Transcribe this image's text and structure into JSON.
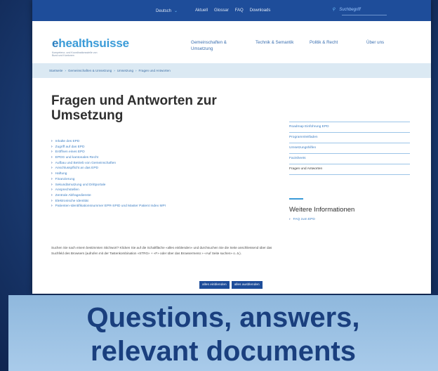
{
  "topbar": {
    "language": "Deutsch",
    "links": [
      "Aktuell",
      "Glossar",
      "FAQ",
      "Downloads"
    ],
    "search_placeholder": "Suchbegriff"
  },
  "header": {
    "logo_e": "e",
    "logo_rest": "healthsuisse",
    "logo_tagline": "Kompetenz- und Koordinationsstelle von Bund und Kantonen",
    "nav": [
      "Gemeinschaften &",
      "Umsetzung",
      "Technik & Semantik",
      "Politik & Recht",
      "Über uns"
    ]
  },
  "breadcrumb": [
    "Startseite",
    "Gemeinschaften & Umsetzung",
    "Umsetzung",
    "Fragen und Antworten"
  ],
  "main": {
    "title": "Fragen und Antworten zur Umsetzung",
    "faq_items": [
      "Inhalte des EPD",
      "Zugriff auf das EPD",
      "Eröffnen eines EPD",
      "EPDG und kantonales Recht",
      "Aufbau und Betrieb von Gemeinschaften",
      "Anschlusspflicht an das EPD",
      "Haftung",
      "Finanzierung",
      "Sekundärnutzung und Drittportale",
      "Ansprechstellen",
      "Zentrale Abfragedienste",
      "Elektronische Identität",
      "Patienten-Identifikationsnummer EPR-SPID und Master Patient Index MPI"
    ],
    "paragraph": "Suchen Sie nach einem bestimmten Stichwort? Klicken Sie auf die Schaltfläche «alles einblenden» und durchsuchen Sie die Seite anschliessend über das Suchfeld des Browsers (aufrufen mit der Tastenkombination «STRG» + «F» oder über das Browsermenü » «Auf Seite suchen» o. ä.).",
    "expand_all": "alles einblenden",
    "collapse_all": "alles ausblenden"
  },
  "sidebar": {
    "items": [
      "Roadmap Einführung EPD",
      "Programmleitfaden",
      "Umsetzungshilfen",
      "Factsheets",
      "Fragen und Antworten"
    ],
    "more_title": "Weitere Informationen",
    "more_link": "FAQ zum EPD"
  },
  "caption": {
    "line1": "Questions, answers,",
    "line2": "relevant documents"
  }
}
